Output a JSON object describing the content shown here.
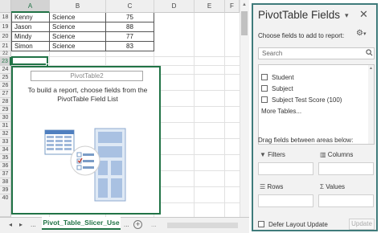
{
  "sheet": {
    "columns": [
      "A",
      "B",
      "C",
      "D",
      "E",
      "F"
    ],
    "rows": [
      {
        "num": "18",
        "name": "Kenny",
        "subject": "Science",
        "score": "75"
      },
      {
        "num": "19",
        "name": "Jason",
        "subject": "Science",
        "score": "88"
      },
      {
        "num": "20",
        "name": "Mindy",
        "subject": "Science",
        "score": "77"
      },
      {
        "num": "21",
        "name": "Simon",
        "subject": "Science",
        "score": "83"
      }
    ],
    "empty_rows": [
      "22",
      "23",
      "24",
      "25",
      "26",
      "27",
      "28",
      "29",
      "30",
      "31",
      "32",
      "33",
      "34",
      "35",
      "36",
      "37",
      "38",
      "39",
      "40"
    ],
    "active_row": "23"
  },
  "pivot": {
    "title": "PivotTable2",
    "message": "To build a report, choose fields from the PivotTable Field List"
  },
  "tabs": {
    "prev": "◂",
    "next": "▸",
    "ellipsis": "...",
    "active_sheet": "Pivot_Table_Slicer_Use",
    "add": "+"
  },
  "pane": {
    "title": "PivotTable Fields",
    "choose_label": "Choose fields to add to report:",
    "search_placeholder": "Search",
    "fields": [
      "Student",
      "Subject",
      "Subject Test Score (100)"
    ],
    "more_tables": "More Tables...",
    "drag_label": "Drag fields between areas below:",
    "areas": {
      "filters": "Filters",
      "columns": "Columns",
      "rows": "Rows",
      "values": "Values"
    },
    "defer_label": "Defer Layout Update",
    "update_label": "Update"
  },
  "colors": {
    "accent": "#217346",
    "pane_border": "#3f7b7b"
  }
}
